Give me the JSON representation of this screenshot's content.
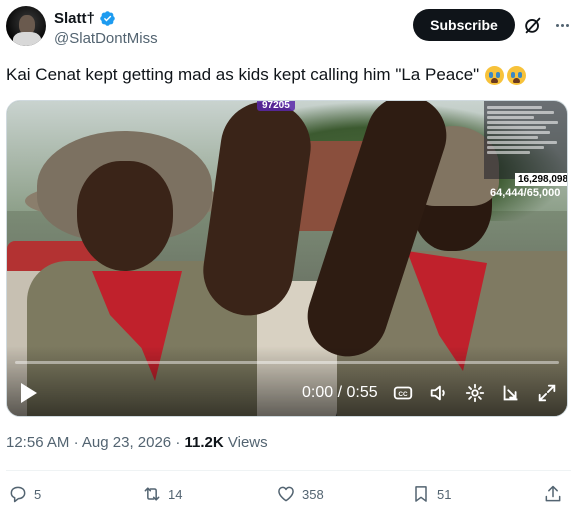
{
  "author": {
    "display_name": "Slatt†",
    "handle": "@SlatDontMiss",
    "avatar_icon": "avatar"
  },
  "header": {
    "subscribe_label": "Subscribe",
    "grok_icon": "grok-icon",
    "more_icon": "more-icon"
  },
  "tweet": {
    "text": "Kai Cenat kept getting mad as kids kept calling him \"La Peace\"",
    "emojis": [
      "loudly-crying-face",
      "loudly-crying-face"
    ]
  },
  "video": {
    "stream_viewer_badge": "97205",
    "subs_counter_top": "16,298,098",
    "subs_counter_bottom": "64,444/65,000",
    "time_display": "0:00 / 0:55",
    "progress": 0
  },
  "meta": {
    "time": "12:56 AM",
    "date": "Aug 23, 2026",
    "views_count": "11.2K",
    "views_label": "Views"
  },
  "actions": {
    "replies": "5",
    "reposts": "14",
    "likes": "358",
    "bookmarks": "51"
  },
  "colors": {
    "accent": "#1d9bf0",
    "text_primary": "#0f1419",
    "text_secondary": "#536471",
    "bandana_red": "#c0212c"
  }
}
